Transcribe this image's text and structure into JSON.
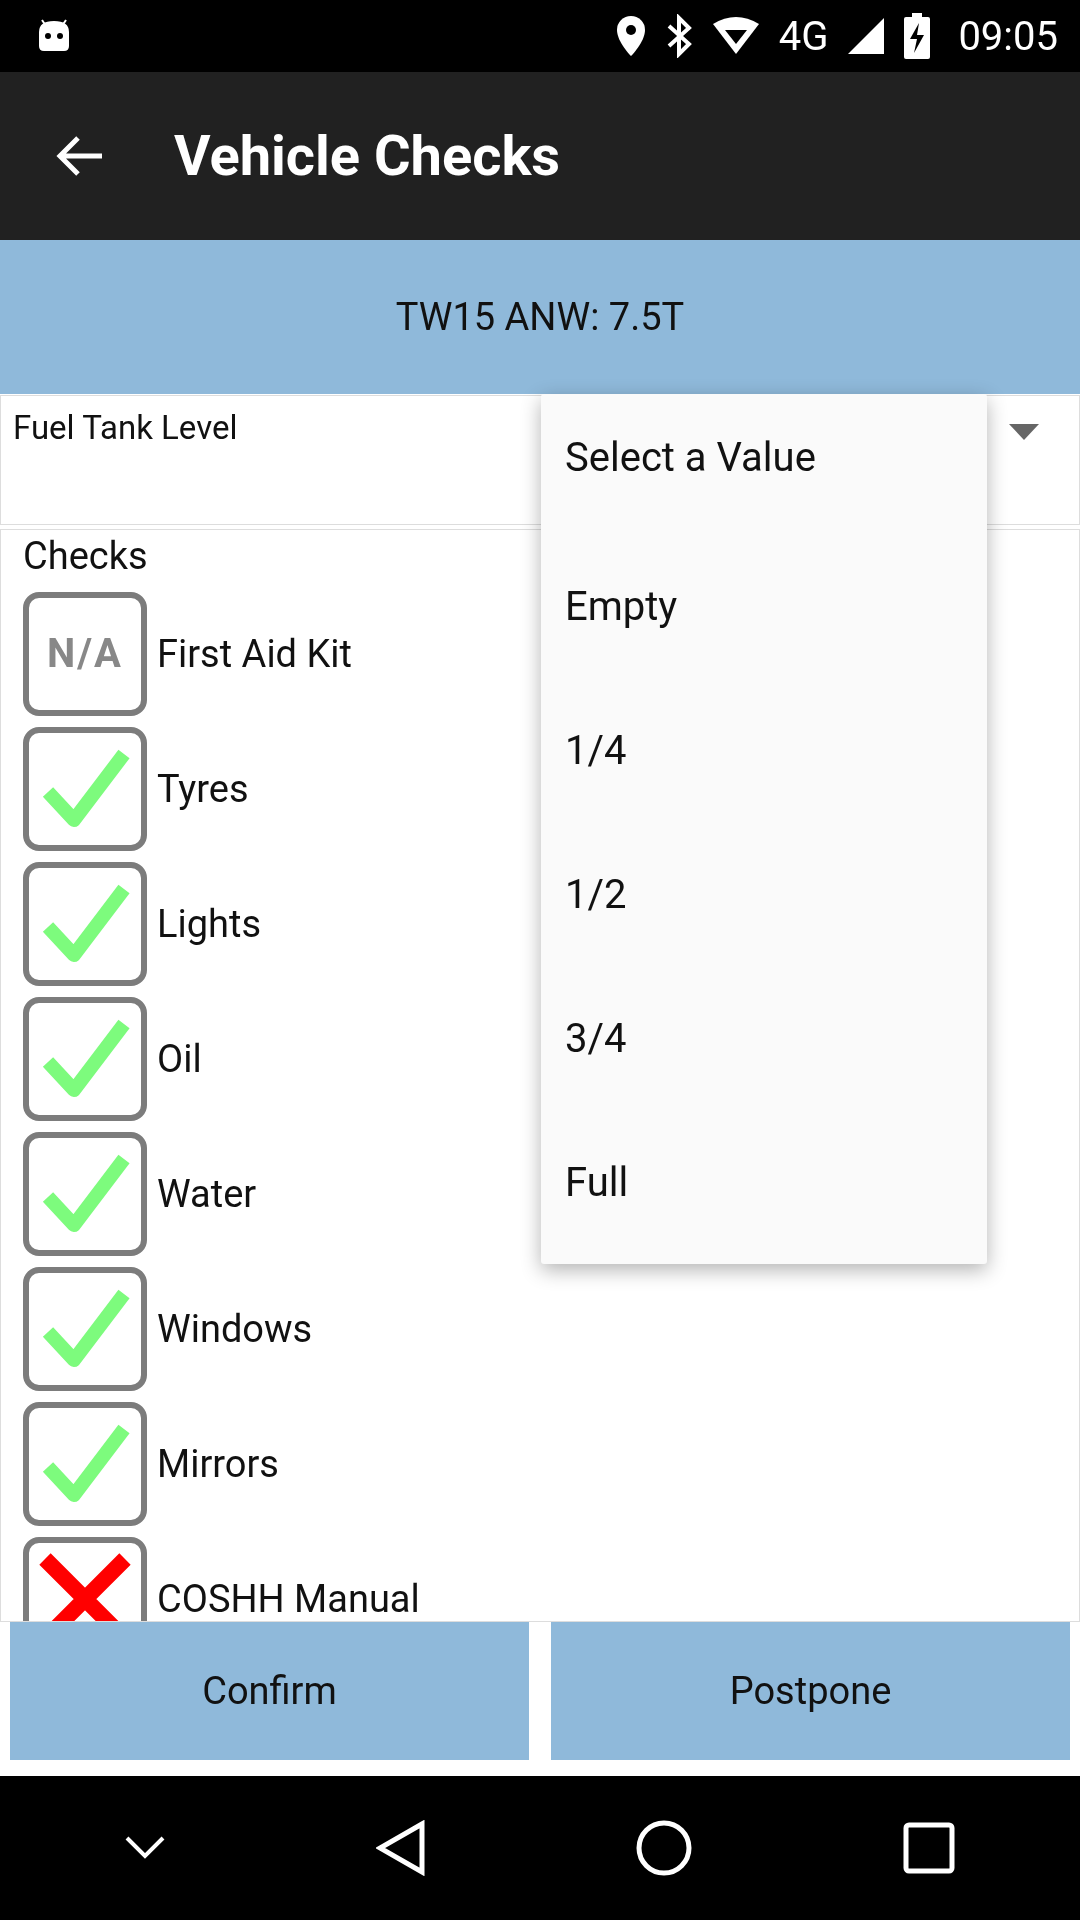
{
  "status_bar": {
    "network": "4G",
    "time": "09:05"
  },
  "app_bar": {
    "title": "Vehicle Checks"
  },
  "vehicle": {
    "label": "TW15 ANW: 7.5T"
  },
  "fuel": {
    "label": "Fuel Tank Level"
  },
  "dropdown": {
    "options": [
      {
        "label": "Select a Value"
      },
      {
        "label": "Empty"
      },
      {
        "label": "1/4"
      },
      {
        "label": "1/2"
      },
      {
        "label": "3/4"
      },
      {
        "label": "Full"
      }
    ]
  },
  "checks": {
    "heading": "Checks",
    "items": [
      {
        "label": "First Aid Kit",
        "checked": false,
        "na_text": "N/A"
      },
      {
        "label": "Tyres",
        "checked": true
      },
      {
        "label": "Lights",
        "checked": true
      },
      {
        "label": "Oil",
        "checked": true
      },
      {
        "label": "Water",
        "checked": true
      },
      {
        "label": "Windows",
        "checked": true
      },
      {
        "label": "Mirrors",
        "checked": true
      },
      {
        "label": "COSHH Manual",
        "checked": false
      }
    ]
  },
  "buttons": [
    {
      "label": "Confirm"
    },
    {
      "label": "Postpone"
    }
  ]
}
